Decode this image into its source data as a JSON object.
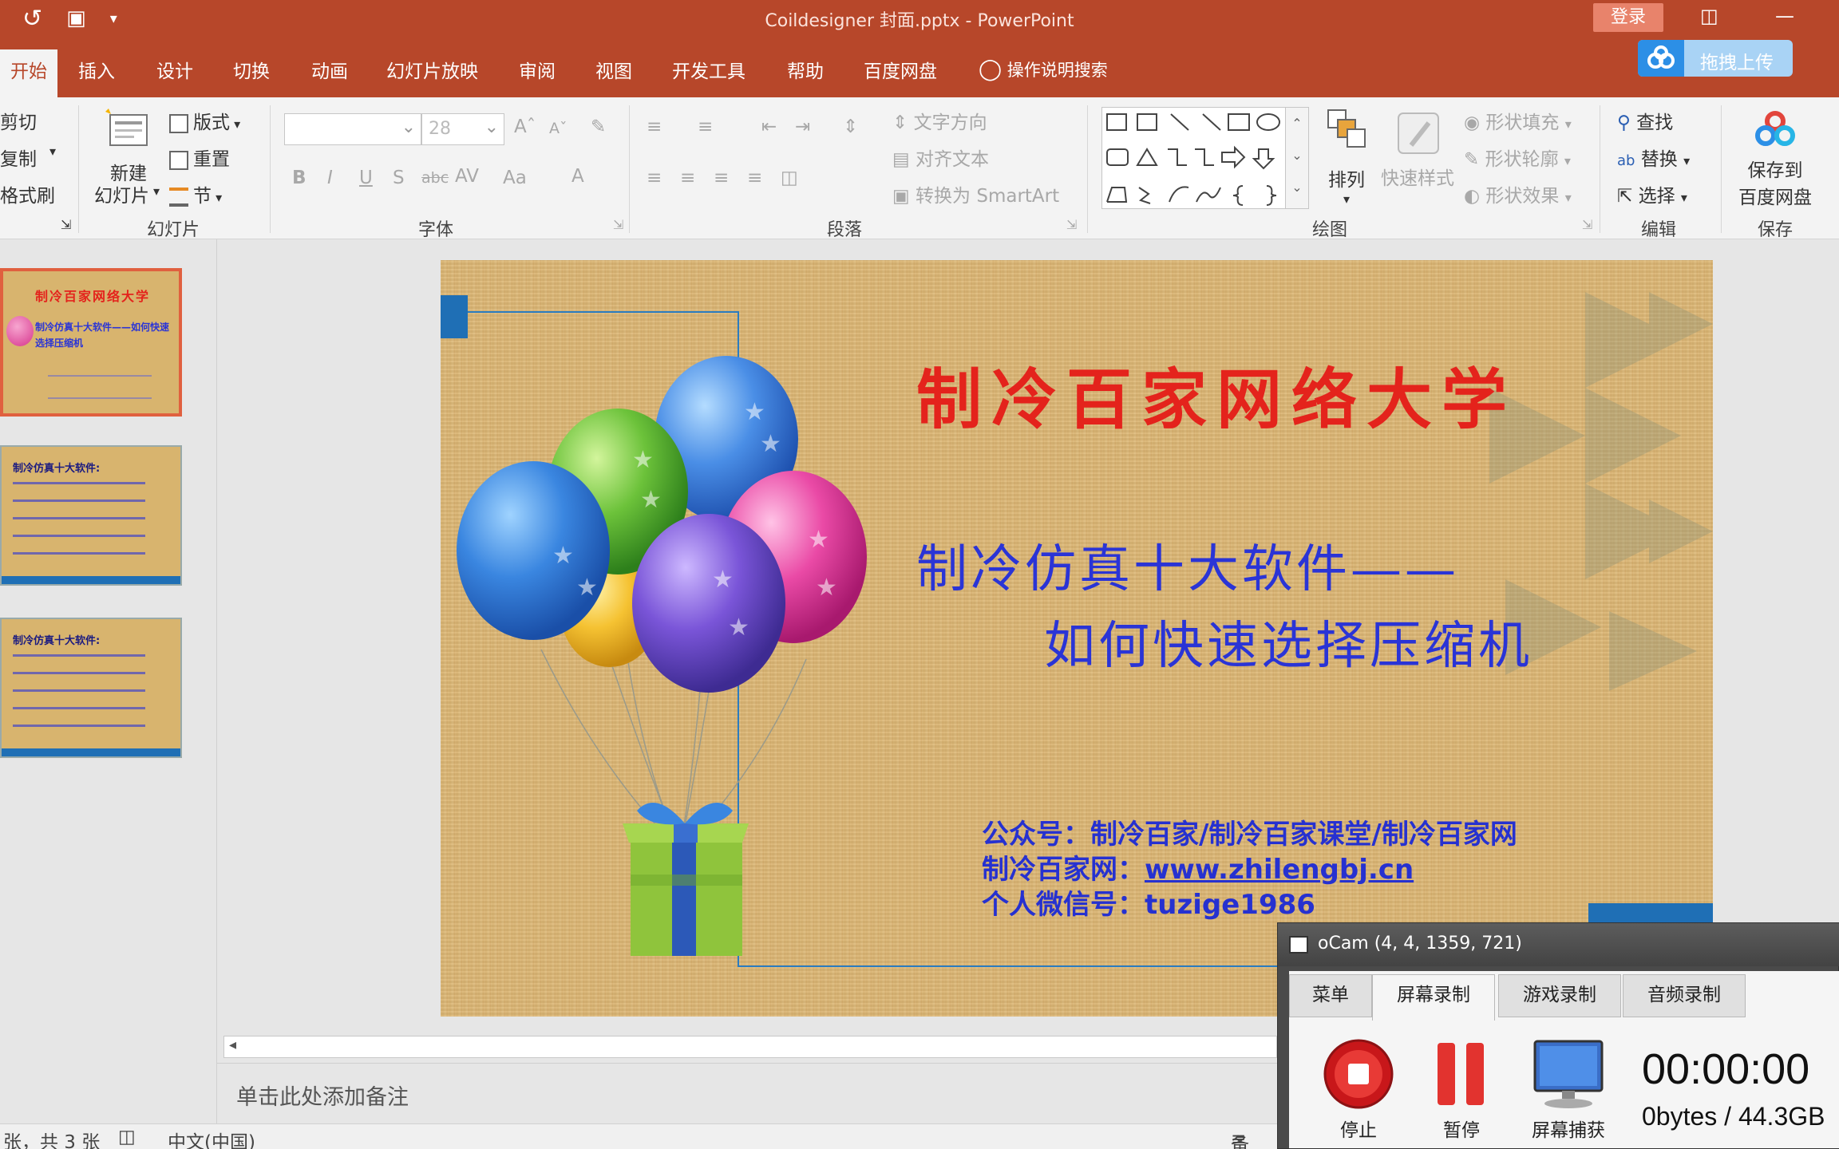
{
  "app": {
    "title": "Coildesigner 封面.pptx  -  PowerPoint",
    "login": "登录"
  },
  "tabs": {
    "active": "开始",
    "items": [
      "插入",
      "设计",
      "切换",
      "动画",
      "幻灯片放映",
      "审阅",
      "视图",
      "开发工具",
      "帮助",
      "百度网盘"
    ],
    "tell_me": "操作说明搜索",
    "upload": "拖拽上传"
  },
  "ribbon": {
    "clipboard": {
      "cut": "剪切",
      "copy": "复制",
      "format_painter": "格式刷"
    },
    "slides": {
      "new_slide_1": "新建",
      "new_slide_2": "幻灯片",
      "layout": "版式",
      "reset": "重置",
      "section": "节",
      "label": "幻灯片"
    },
    "font": {
      "size": "28",
      "label": "字体"
    },
    "paragraph": {
      "text_direction": "文字方向",
      "align_text": "对齐文本",
      "smartart": "转换为 SmartArt",
      "label": "段落"
    },
    "drawing": {
      "arrange": "排列",
      "quick_styles": "快速样式",
      "shape_fill": "形状填充",
      "shape_outline": "形状轮廓",
      "shape_effects": "形状效果",
      "label": "绘图"
    },
    "editing": {
      "find": "查找",
      "replace": "替换",
      "select": "选择",
      "label": "编辑"
    },
    "save": {
      "save_1": "保存到",
      "save_2": "百度网盘",
      "label": "保存"
    }
  },
  "slide": {
    "title": "制冷百家网络大学",
    "subtitle_1": "制冷仿真十大软件——",
    "subtitle_2": "如何快速选择压缩机",
    "info_1": "公众号：制冷百家/制冷百家课堂/制冷百家网",
    "info_2_label": "制冷百家网：",
    "info_2_link": "www.zhilengbj.cn",
    "info_3": "个人微信号：tuzige1986"
  },
  "thumbs": {
    "t1_title": "制冷百家网络大学",
    "t1_sub": "制冷仿真十大软件——如何快速选择压缩机",
    "t2_title": "制冷仿真十大软件:",
    "t3_title": "制冷仿真十大软件:"
  },
  "notes": {
    "placeholder": "单击此处添加备注"
  },
  "status": {
    "slide_count": "张，共 3 张",
    "language": "中文(中国)",
    "notes_btn": "备"
  },
  "ocam": {
    "title": "oCam (4, 4, 1359, 721)",
    "tabs": [
      "菜单",
      "屏幕录制",
      "游戏录制",
      "音频录制"
    ],
    "stop": "停止",
    "pause": "暂停",
    "capture": "屏幕捕获",
    "timer": "00:00:00",
    "size": "0bytes / 44.3GB"
  },
  "colors": {
    "accent": "#b7472a",
    "slide_title": "#e4231c",
    "slide_sub": "#2a34d6"
  }
}
